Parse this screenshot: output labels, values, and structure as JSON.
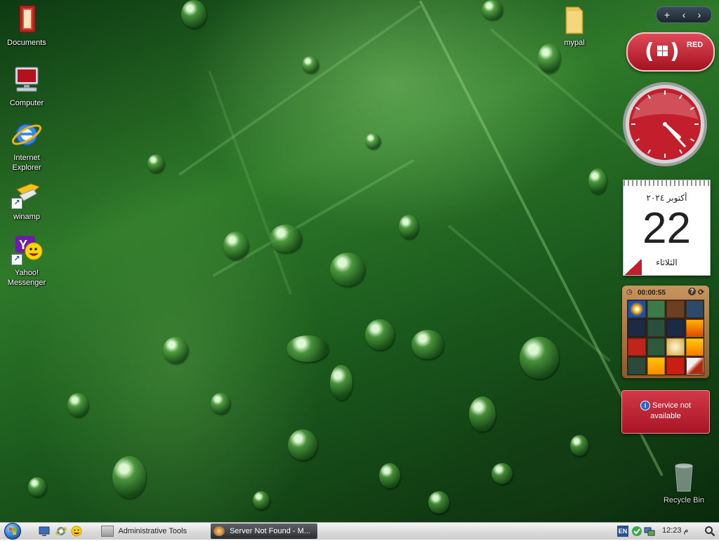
{
  "desktop": {
    "icons": [
      {
        "label": "Documents",
        "icon": "documents-folder-icon"
      },
      {
        "label": "Computer",
        "icon": "computer-icon"
      },
      {
        "label": "Internet Explorer",
        "icon": "internet-explorer-icon"
      },
      {
        "label": "winamp",
        "icon": "winamp-shortcut-icon"
      },
      {
        "label": "Yahoo! Messenger",
        "icon": "yahoo-messenger-shortcut-icon"
      },
      {
        "label": "mypal",
        "icon": "folder-icon"
      },
      {
        "label": "Recycle Bin",
        "icon": "recycle-bin-icon"
      }
    ]
  },
  "sidebar": {
    "add_button": "+",
    "red_gadget": {
      "text": "RED",
      "brand_color": "#c31e2b"
    },
    "clock": {
      "hour": 4,
      "minute": 23,
      "second": 0
    },
    "calendar": {
      "month_year": "أكتوبر ٢٠٢٤",
      "day": "22",
      "weekday": "الثلاثاء"
    },
    "puzzle": {
      "timer": "00:00:55"
    },
    "service": {
      "line1": "Service not",
      "line2": "available"
    }
  },
  "taskbar": {
    "tasks": [
      {
        "label": "Administrative Tools",
        "active": false
      },
      {
        "label": "Server Not Found - M...",
        "active": true
      }
    ],
    "tray": {
      "language": "EN",
      "time": "12:23 م"
    }
  },
  "colors": {
    "accent_red": "#c31e2b",
    "taskbar": "#e6e6e6",
    "wallpaper": "#2f7a2a"
  }
}
